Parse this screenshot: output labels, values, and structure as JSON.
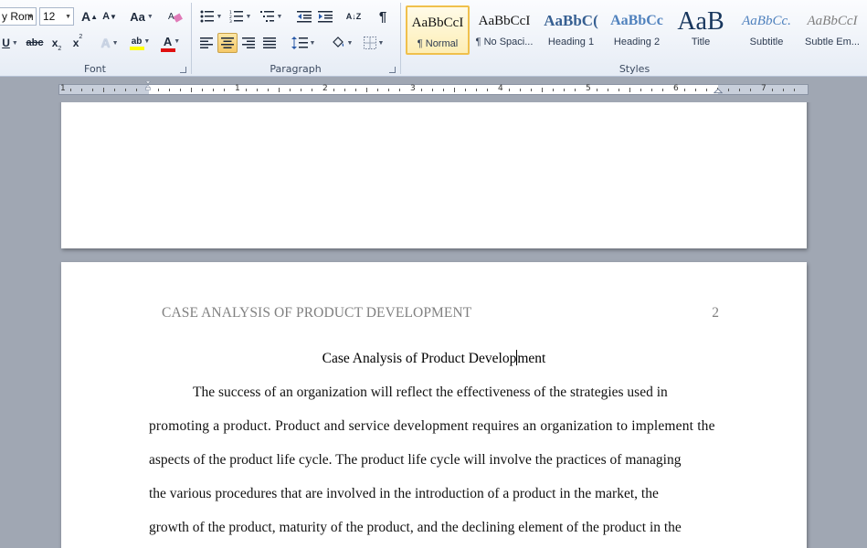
{
  "ribbon": {
    "font": {
      "group_label": "Font",
      "font_name": "y Rom",
      "font_size": "12",
      "grow_label": "A",
      "shrink_label": "A",
      "change_case_label": "Aa",
      "underline_label": "U",
      "strike_label": "abc",
      "subscript_label": "x",
      "superscript_label": "x",
      "text_effect_label": "A",
      "highlight_label": "ab",
      "font_color_label": "A",
      "highlight_color": "#ffff00",
      "font_color": "#e01010"
    },
    "paragraph": {
      "group_label": "Paragraph",
      "sort_label": "A↓Z",
      "pilcrow_label": "¶"
    },
    "styles": {
      "group_label": "Styles",
      "items": [
        {
          "sample": "AaBbCcI",
          "name": "¶ Normal"
        },
        {
          "sample": "AaBbCcI",
          "name": "¶ No Spaci..."
        },
        {
          "sample": "AaBbC(",
          "name": "Heading 1"
        },
        {
          "sample": "AaBbCc",
          "name": "Heading 2"
        },
        {
          "sample": "AaB",
          "name": "Title"
        },
        {
          "sample": "AaBbCc.",
          "name": "Subtitle"
        },
        {
          "sample": "AaBbCcI",
          "name": "Subtle Em..."
        }
      ]
    }
  },
  "ruler": {
    "numbers": [
      "1",
      "1",
      "2",
      "3",
      "4",
      "5",
      "6",
      "7"
    ]
  },
  "document": {
    "header_title": "CASE ANALYSIS OF PRODUCT DEVELOPMENT",
    "page_number": "2",
    "title_before_caret": "Case Analysis of Product Develop",
    "title_after_caret": "ment",
    "lines": [
      "The success of an organization will reflect the effectiveness of the strategies used in",
      "promoting a product. Product and service development requires an organization to implement the",
      "aspects of the product life cycle. The product life cycle will involve the practices of managing",
      "the various procedures that are involved in the introduction of a product in the market, the",
      "growth of the product, maturity of the product, and the declining element of the product in the"
    ]
  }
}
